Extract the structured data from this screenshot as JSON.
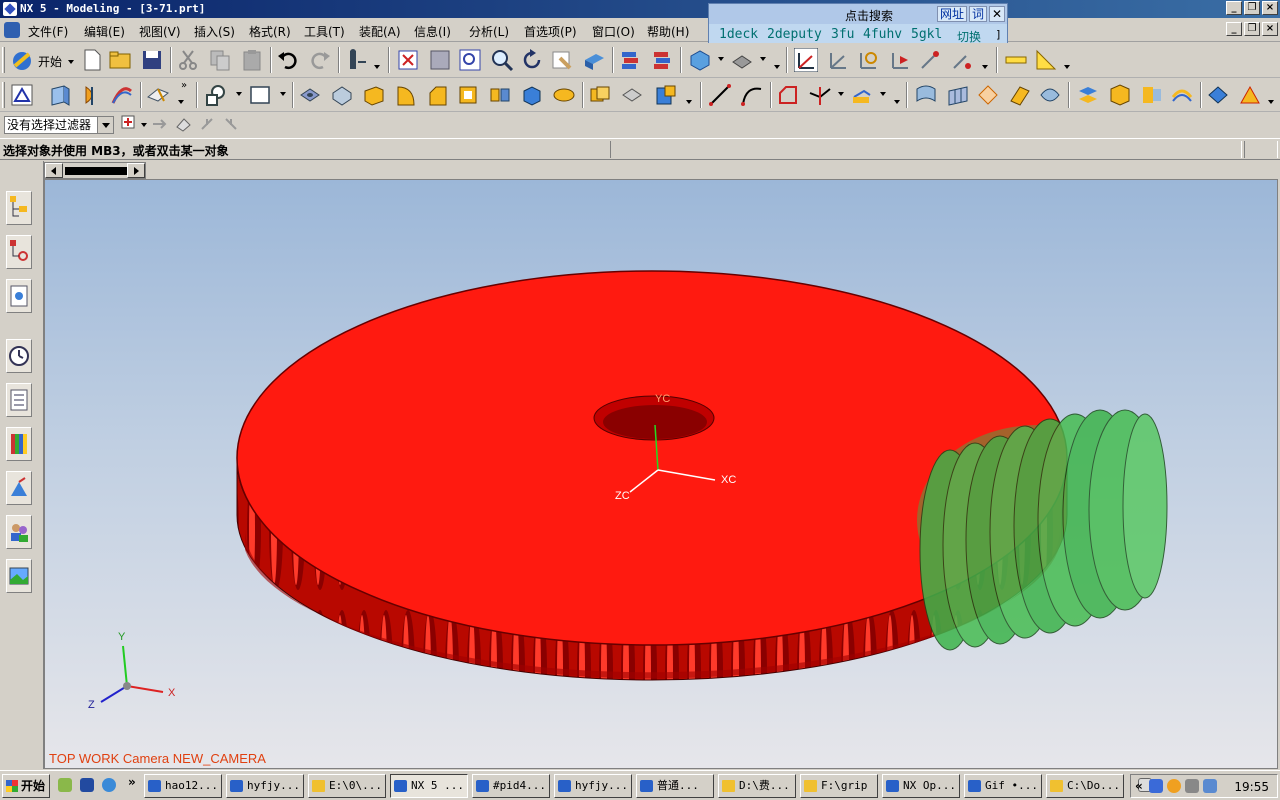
{
  "window": {
    "title": "NX 5 - Modeling - [3-71.prt]"
  },
  "menu": [
    "文件(F)",
    "编辑(E)",
    "视图(V)",
    "插入(S)",
    "格式(R)",
    "工具(T)",
    "装配(A)",
    "信息(I)",
    "分析(L)",
    "首选项(P)",
    "窗口(O)",
    "帮助(H)"
  ],
  "search_popup": {
    "label": "点击搜索",
    "buttons": [
      "网址",
      "词"
    ],
    "keywords": [
      "1deck",
      "2deputy",
      "3fu",
      "4fuhv",
      "5gkl"
    ],
    "switch_label": "切换"
  },
  "toolbar": {
    "start_label": "开始"
  },
  "filter": {
    "value": "没有选择过滤器"
  },
  "cue_line": "选择对象并使用 MB3，或者双击某一对象",
  "graphics": {
    "camera_label": "TOP WORK Camera NEW_CAMERA",
    "wcs_labels": {
      "xc": "XC",
      "yc": "YC",
      "zc": "ZC"
    },
    "triad_labels": {
      "x": "X",
      "y": "Y",
      "z": "Z"
    },
    "colors": {
      "gear": "#ff1a10",
      "worm": "#3cb44a",
      "bg_top": "#9cb7d8",
      "bg_bottom": "#e6e6ea"
    }
  },
  "taskbar": {
    "start": "开始",
    "tasks": [
      "hao12...",
      "hyfjy...",
      "E:\\0\\...",
      "NX 5 ...",
      "#pid4...",
      "hyfjy...",
      "普通...",
      "D:\\费...",
      "F:\\grip",
      "NX Op...",
      "Gif •...",
      "C:\\Do..."
    ],
    "clock": "19:55"
  }
}
